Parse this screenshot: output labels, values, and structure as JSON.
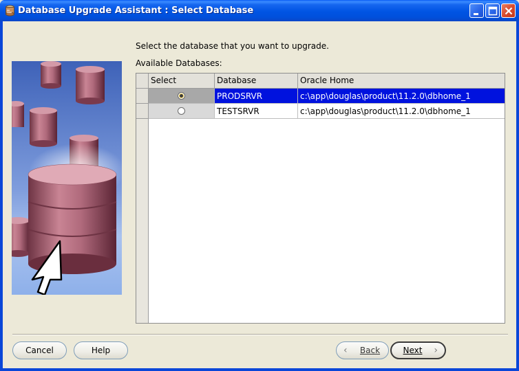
{
  "window": {
    "title": "Database Upgrade Assistant : Select Database"
  },
  "main": {
    "instruction": "Select the database that you want to upgrade.",
    "available_label": "Available Databases:",
    "columns": [
      "Select",
      "Database",
      "Oracle Home"
    ],
    "rows": [
      {
        "selected": true,
        "database": "PRODSRVR",
        "oracle_home": "c:\\app\\douglas\\product\\11.2.0\\dbhome_1"
      },
      {
        "selected": false,
        "database": "TESTSRVR",
        "oracle_home": "c:\\app\\douglas\\product\\11.2.0\\dbhome_1"
      }
    ]
  },
  "buttons": {
    "cancel": "Cancel",
    "help": "Help",
    "back": "Back",
    "next": "Next"
  },
  "colors": {
    "titlebar": "#0054e3",
    "selection": "#0012de",
    "dialog_bg": "#ece9d8"
  },
  "icons": [
    "oracle-app-icon",
    "minimize-icon",
    "maximize-icon",
    "close-icon",
    "back-arrow-icon",
    "next-arrow-icon"
  ]
}
